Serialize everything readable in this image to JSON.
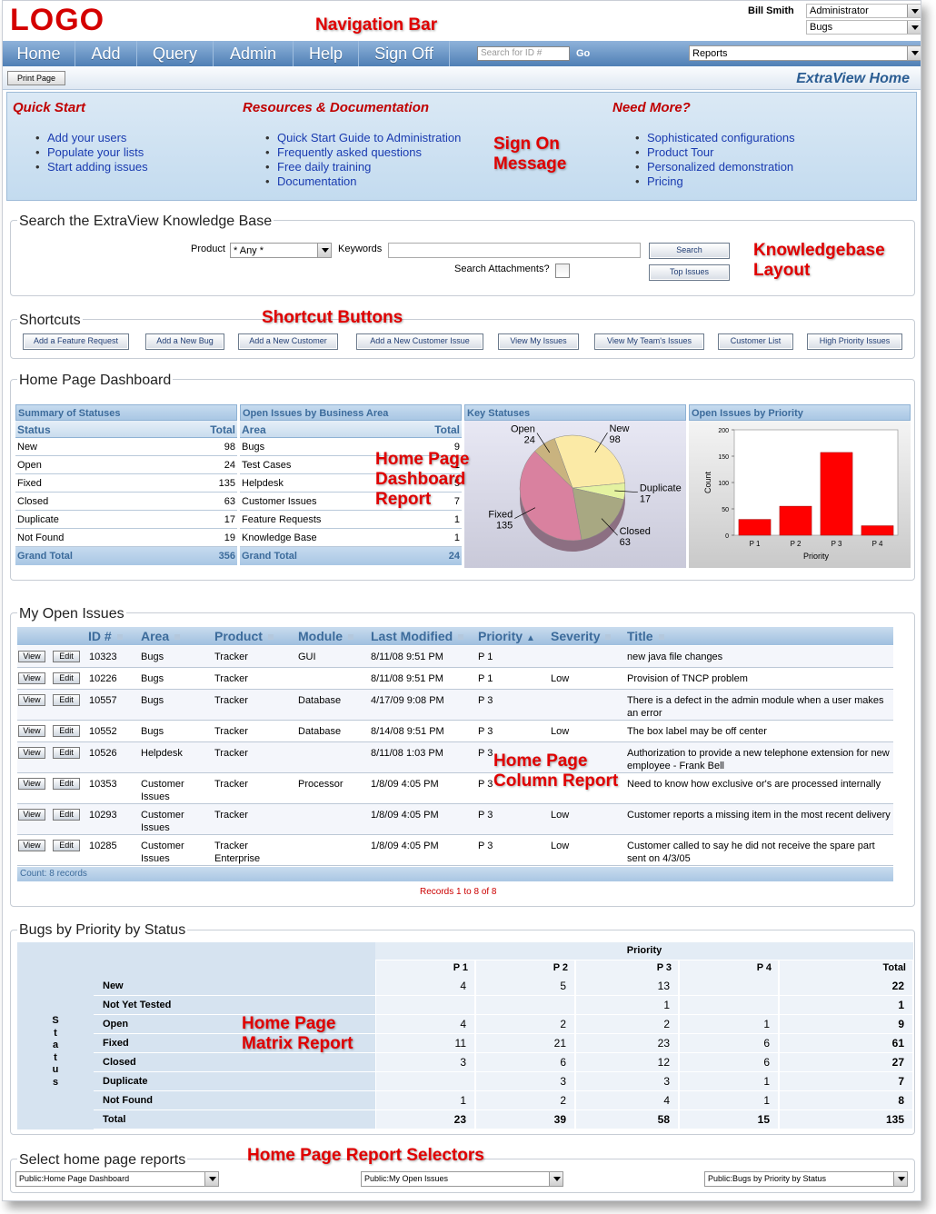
{
  "header": {
    "logo": "LOGO",
    "user_name": "Bill Smith",
    "role_select": "Administrator",
    "project_select": "Bugs"
  },
  "nav": {
    "items": [
      "Home",
      "Add",
      "Query",
      "Admin",
      "Help",
      "Sign Off"
    ],
    "search_placeholder": "Search for ID #",
    "go": "Go",
    "reports_select": "Reports"
  },
  "toolbar": {
    "print_label": "Print Page",
    "page_title": "ExtraView Home"
  },
  "signon": {
    "quick_start": {
      "title": "Quick Start",
      "items": [
        "Add your users",
        "Populate your lists",
        "Start adding issues"
      ]
    },
    "resources": {
      "title": "Resources & Documentation",
      "items": [
        "Quick Start Guide to Administration",
        "Frequently asked questions",
        "Free daily training",
        "Documentation"
      ]
    },
    "need_more": {
      "title": "Need More?",
      "items": [
        "Sophisticated configurations",
        "Product Tour",
        "Personalized demonstration",
        "Pricing"
      ]
    }
  },
  "kb": {
    "title": "Search the ExtraView Knowledge Base",
    "product_label": "Product",
    "product_value": "* Any *",
    "keywords_label": "Keywords",
    "attachments_label": "Search Attachments?",
    "search_button": "Search",
    "top_issues_button": "Top Issues"
  },
  "shortcuts": {
    "title": "Shortcuts",
    "buttons": [
      "Add a Feature Request",
      "Add a New Bug",
      "Add a New Customer",
      "Add a New Customer Issue",
      "View My Issues",
      "View My Team's Issues",
      "Customer List",
      "High Priority Issues"
    ]
  },
  "dashboard": {
    "title": "Home Page Dashboard",
    "summary": {
      "title": "Summary of Statuses",
      "col1": "Status",
      "col2": "Total",
      "rows": [
        {
          "label": "New",
          "value": "98"
        },
        {
          "label": "Open",
          "value": "24"
        },
        {
          "label": "Fixed",
          "value": "135"
        },
        {
          "label": "Closed",
          "value": "63"
        },
        {
          "label": "Duplicate",
          "value": "17"
        },
        {
          "label": "Not Found",
          "value": "19"
        }
      ],
      "total_label": "Grand Total",
      "total_value": "356"
    },
    "business": {
      "title": "Open Issues by Business Area",
      "col1": "Area",
      "col2": "Total",
      "rows": [
        {
          "label": "Bugs",
          "value": "9"
        },
        {
          "label": "Test Cases",
          "value": "1"
        },
        {
          "label": "Helpdesk",
          "value": "5"
        },
        {
          "label": "Customer Issues",
          "value": "7"
        },
        {
          "label": "Feature Requests",
          "value": "1"
        },
        {
          "label": "Knowledge Base",
          "value": "1"
        }
      ],
      "total_label": "Grand Total",
      "total_value": "24"
    },
    "key_statuses_title": "Key Statuses",
    "priority_title": "Open Issues by Priority"
  },
  "chart_data": [
    {
      "type": "pie",
      "title": "Key Statuses",
      "categories": [
        "New",
        "Duplicate",
        "Closed",
        "Fixed",
        "Open"
      ],
      "values": [
        98,
        17,
        63,
        135,
        24
      ],
      "colors": [
        "#fbeaa6",
        "#e4f2a0",
        "#a8a882",
        "#d9819f",
        "#c9b37f"
      ]
    },
    {
      "type": "bar",
      "title": "Open Issues by Priority",
      "categories": [
        "P 1",
        "P 2",
        "P 3",
        "P 4"
      ],
      "values": [
        30,
        55,
        157,
        18
      ],
      "xlabel": "Priority",
      "ylabel": "Count",
      "ylim": [
        0,
        200
      ],
      "yticks": [
        "0",
        "50",
        "100",
        "150",
        "200"
      ],
      "color": "#ff0000"
    }
  ],
  "open_issues": {
    "title": "My Open Issues",
    "columns": [
      "ID #",
      "Area",
      "Product",
      "Module",
      "Last Modified",
      "Priority",
      "Severity",
      "Title"
    ],
    "view_label": "View",
    "edit_label": "Edit",
    "rows": [
      {
        "id": "10323",
        "area": "Bugs",
        "product": "Tracker",
        "module": "GUI",
        "modified": "8/11/08 9:51 PM",
        "priority": "P 1",
        "severity": "",
        "title": "new java file changes"
      },
      {
        "id": "10226",
        "area": "Bugs",
        "product": "Tracker",
        "module": "",
        "modified": "8/11/08 9:51 PM",
        "priority": "P 1",
        "severity": "Low",
        "title": "Provision of TNCP problem"
      },
      {
        "id": "10557",
        "area": "Bugs",
        "product": "Tracker",
        "module": "Database",
        "modified": "4/17/09 9:08 PM",
        "priority": "P 3",
        "severity": "",
        "title": "There is a defect in the admin module when a user makes an error"
      },
      {
        "id": "10552",
        "area": "Bugs",
        "product": "Tracker",
        "module": "Database",
        "modified": "8/14/08 9:51 PM",
        "priority": "P 3",
        "severity": "Low",
        "title": "The box label may be off center"
      },
      {
        "id": "10526",
        "area": "Helpdesk",
        "product": "Tracker",
        "module": "",
        "modified": "8/11/08 1:03 PM",
        "priority": "P 3",
        "severity": "",
        "title": "Authorization to provide a new telephone extension for new employee - Frank Bell"
      },
      {
        "id": "10353",
        "area": "Customer Issues",
        "product": "Tracker",
        "module": "Processor",
        "modified": "1/8/09 4:05 PM",
        "priority": "P 3",
        "severity": "",
        "title": "Need to know how exclusive or's are processed internally"
      },
      {
        "id": "10293",
        "area": "Customer Issues",
        "product": "Tracker",
        "module": "",
        "modified": "1/8/09 4:05 PM",
        "priority": "P 3",
        "severity": "Low",
        "title": "Customer reports a missing item in the most recent delivery"
      },
      {
        "id": "10285",
        "area": "Customer Issues",
        "product": "Tracker Enterprise",
        "module": "",
        "modified": "1/8/09 4:05 PM",
        "priority": "P 3",
        "severity": "Low",
        "title": "Customer called to say he did not receive the spare part sent on 4/3/05"
      }
    ],
    "count": "Count: 8 records",
    "records": "Records 1 to 8 of 8"
  },
  "matrix": {
    "title": "Bugs by Priority by Status",
    "priority_label": "Priority",
    "status_label": "Status",
    "columns": [
      "P 1",
      "P 2",
      "P 3",
      "P 4",
      "Total"
    ],
    "rows": [
      {
        "label": "New",
        "cells": [
          "4",
          "5",
          "13",
          "",
          "22"
        ]
      },
      {
        "label": "Not Yet Tested",
        "cells": [
          "",
          "",
          "1",
          "",
          "1"
        ]
      },
      {
        "label": "Open",
        "cells": [
          "4",
          "2",
          "2",
          "1",
          "9"
        ]
      },
      {
        "label": "Fixed",
        "cells": [
          "11",
          "21",
          "23",
          "6",
          "61"
        ]
      },
      {
        "label": "Closed",
        "cells": [
          "3",
          "6",
          "12",
          "6",
          "27"
        ]
      },
      {
        "label": "Duplicate",
        "cells": [
          "",
          "3",
          "3",
          "1",
          "7"
        ]
      },
      {
        "label": "Not Found",
        "cells": [
          "1",
          "2",
          "4",
          "1",
          "8"
        ]
      },
      {
        "label": "Total",
        "cells": [
          "23",
          "39",
          "58",
          "15",
          "135"
        ]
      }
    ]
  },
  "selectors": {
    "title": "Select home page reports",
    "values": [
      "Public:Home Page Dashboard",
      "Public:My Open Issues",
      "Public:Bugs by Priority by Status"
    ]
  },
  "annotations": {
    "navigation_bar": "Navigation Bar",
    "sign_on_message": "Sign On\nMessage",
    "knowledgebase_layout": "Knowledgebase\nLayout",
    "shortcut_buttons": "Shortcut Buttons",
    "dashboard_report": "Home Page\nDashboard\nReport",
    "column_report": "Home Page\nColumn Report",
    "matrix_report": "Home Page\nMatrix Report",
    "report_selectors": "Home Page Report Selectors"
  }
}
